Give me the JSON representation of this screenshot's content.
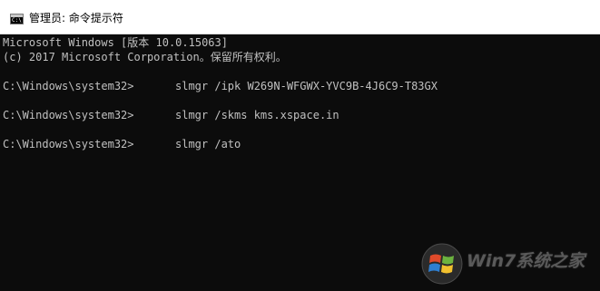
{
  "window": {
    "title": "管理员: 命令提示符",
    "icon": "cmd-console-icon",
    "icon_glyph": "C:\\"
  },
  "console": {
    "header": [
      "Microsoft Windows [版本 10.0.15063]",
      "(c) 2017 Microsoft Corporation。保留所有权利。"
    ],
    "entries": [
      {
        "prompt": "C:\\Windows\\system32>",
        "command": "slmgr /ipk W269N-WFGWX-YVC9B-4J6C9-T83GX"
      },
      {
        "prompt": "C:\\Windows\\system32>",
        "command": "slmgr /skms kms.xspace.in"
      },
      {
        "prompt": "C:\\Windows\\system32>",
        "command": "slmgr /ato"
      }
    ]
  },
  "watermark": {
    "logo": "windows-flag-logo",
    "text": "Win7系统之家"
  },
  "colors": {
    "console_bg": "#0c0c0c",
    "console_fg": "#c0c0c0",
    "titlebar_bg": "#ffffff"
  }
}
